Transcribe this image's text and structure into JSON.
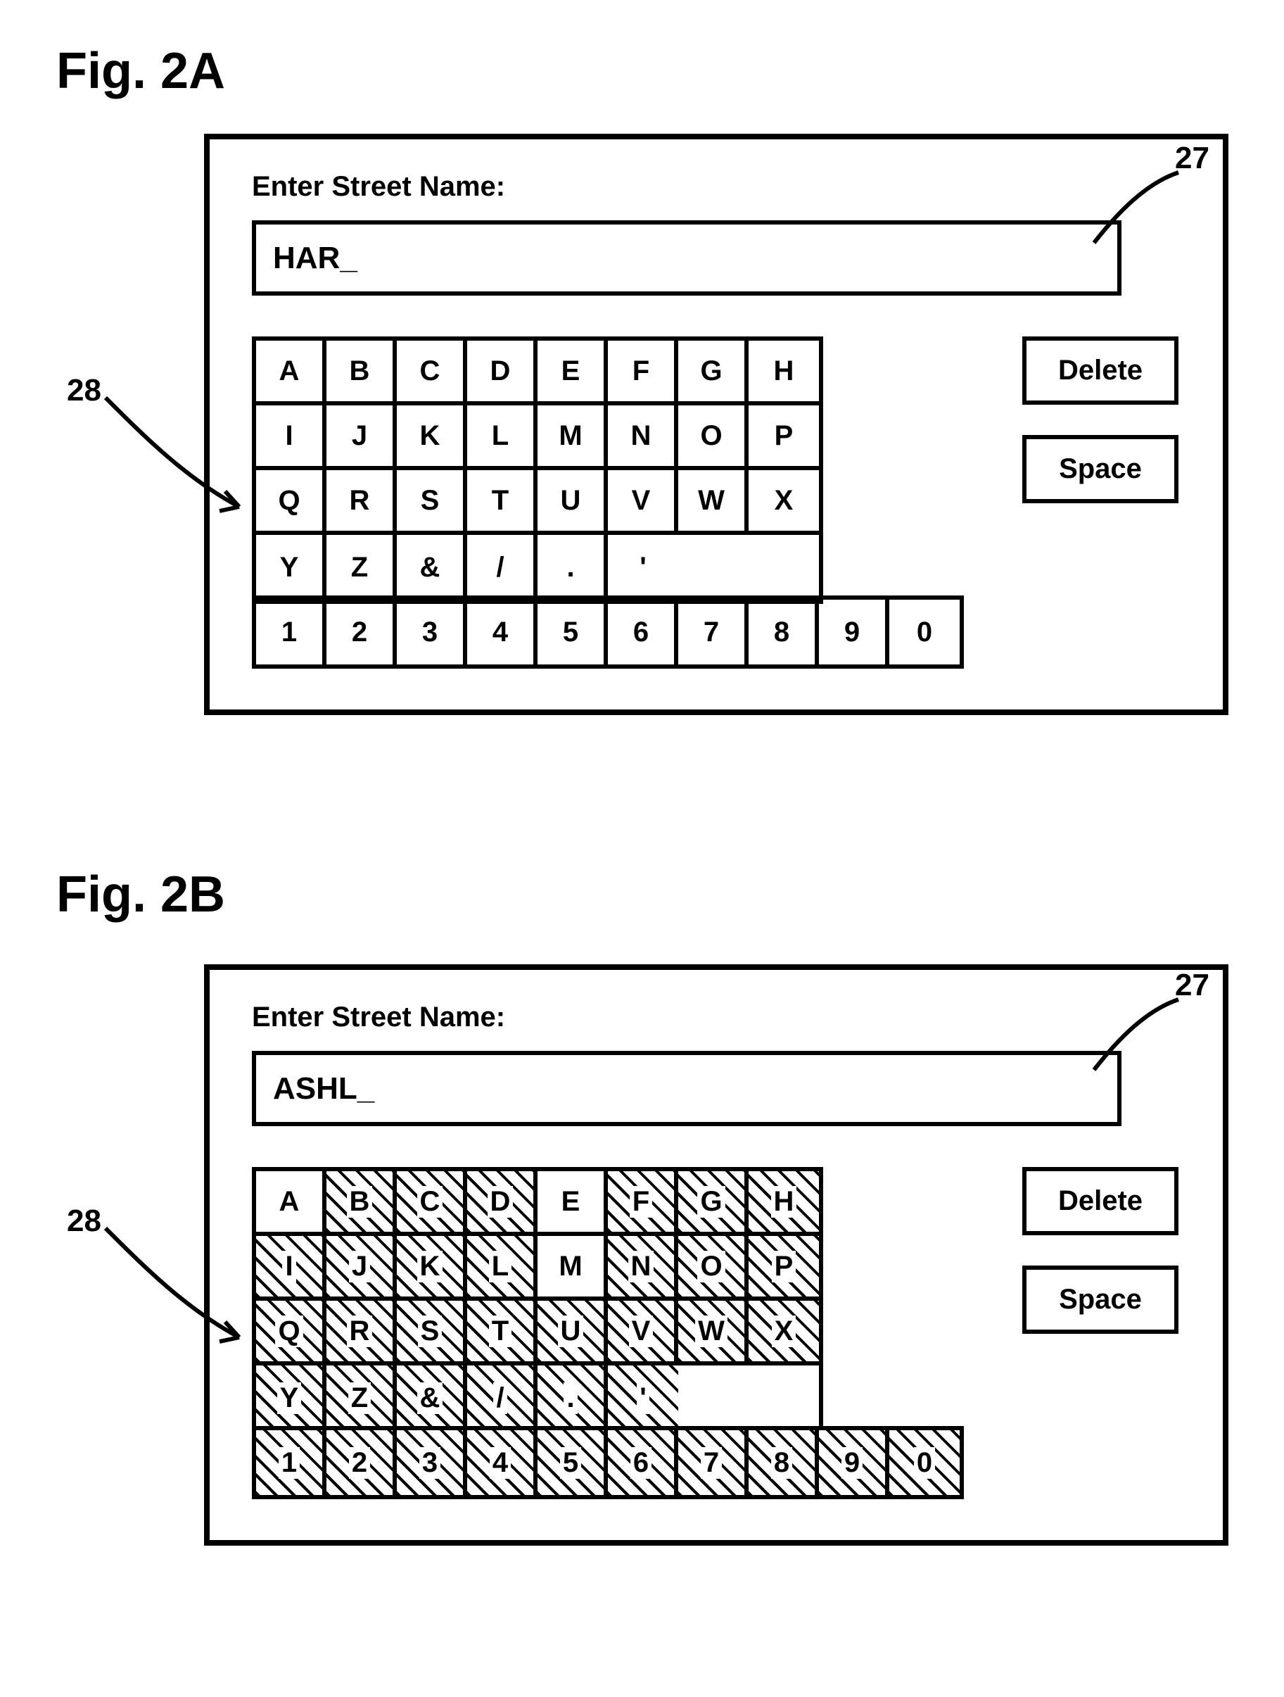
{
  "figA": {
    "title": "Fig. 2A",
    "prompt": "Enter Street Name:",
    "input_value": "HAR_",
    "ref_input": "27",
    "ref_keypad": "28",
    "delete_label": "Delete",
    "space_label": "Space",
    "rows": [
      [
        "A",
        "B",
        "C",
        "D",
        "E",
        "F",
        "G",
        "H"
      ],
      [
        "I",
        "J",
        "K",
        "L",
        "M",
        "N",
        "O",
        "P"
      ],
      [
        "Q",
        "R",
        "S",
        "T",
        "U",
        "V",
        "W",
        "X"
      ],
      [
        "Y",
        "Z",
        "&",
        "/",
        ".",
        "'"
      ]
    ],
    "num_row": [
      "1",
      "2",
      "3",
      "4",
      "5",
      "6",
      "7",
      "8",
      "9",
      "0"
    ],
    "disabled": []
  },
  "figB": {
    "title": "Fig. 2B",
    "prompt": "Enter Street Name:",
    "input_value": "ASHL_",
    "ref_input": "27",
    "ref_keypad": "28",
    "delete_label": "Delete",
    "space_label": "Space",
    "rows": [
      [
        "A",
        "B",
        "C",
        "D",
        "E",
        "F",
        "G",
        "H"
      ],
      [
        "I",
        "J",
        "K",
        "L",
        "M",
        "N",
        "O",
        "P"
      ],
      [
        "Q",
        "R",
        "S",
        "T",
        "U",
        "V",
        "W",
        "X"
      ],
      [
        "Y",
        "Z",
        "&",
        "/",
        ".",
        "'"
      ]
    ],
    "num_row": [
      "1",
      "2",
      "3",
      "4",
      "5",
      "6",
      "7",
      "8",
      "9",
      "0"
    ],
    "disabled": [
      "B",
      "C",
      "D",
      "F",
      "G",
      "H",
      "I",
      "J",
      "K",
      "L",
      "N",
      "O",
      "P",
      "Q",
      "R",
      "S",
      "T",
      "U",
      "V",
      "W",
      "X",
      "Y",
      "Z",
      "&",
      "/",
      ".",
      "'",
      "1",
      "2",
      "3",
      "4",
      "5",
      "6",
      "7",
      "8",
      "9",
      "0"
    ]
  }
}
